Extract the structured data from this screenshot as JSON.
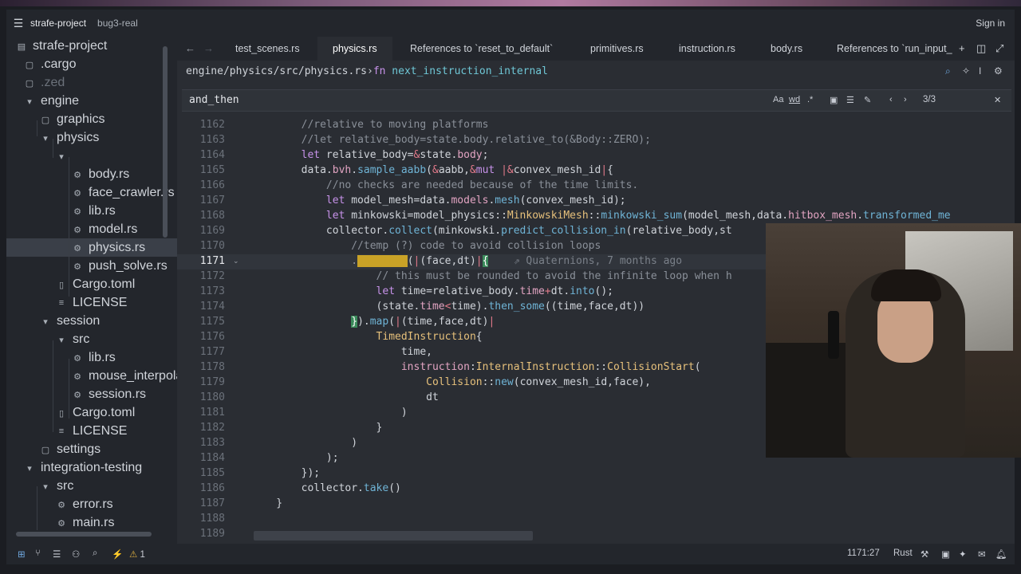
{
  "titlebar": {
    "menu_icon": "hamburger-icon",
    "project": "strafe-project",
    "branch": "bug3-real",
    "signin": "Sign in"
  },
  "sidebar": {
    "rows": [
      {
        "label": "strafe-project",
        "icon": "repo-icon",
        "depth": 0
      },
      {
        "label": ".cargo",
        "icon": "folder-icon",
        "depth": 1
      },
      {
        "label": ".zed",
        "icon": "folder-icon",
        "depth": 1
      },
      {
        "label": "engine",
        "icon": "folder-open-icon",
        "depth": 1
      },
      {
        "label": "graphics",
        "icon": "folder-icon",
        "depth": 2
      },
      {
        "label": "physics",
        "icon": "folder-open-icon",
        "depth": 2
      },
      {
        "label": "",
        "icon": "folder-open-icon",
        "depth": 3
      },
      {
        "label": "body.rs",
        "icon": "rust-file-icon",
        "depth": 4
      },
      {
        "label": "face_crawler.rs",
        "icon": "rust-file-icon",
        "depth": 4
      },
      {
        "label": "lib.rs",
        "icon": "rust-file-icon",
        "depth": 4
      },
      {
        "label": "model.rs",
        "icon": "rust-file-icon",
        "depth": 4
      },
      {
        "label": "physics.rs",
        "icon": "rust-file-icon",
        "depth": 4
      },
      {
        "label": "push_solve.rs",
        "icon": "rust-file-icon",
        "depth": 4
      },
      {
        "label": "Cargo.toml",
        "icon": "toml-file-icon",
        "depth": 3
      },
      {
        "label": "LICENSE",
        "icon": "text-file-icon",
        "depth": 3
      },
      {
        "label": "session",
        "icon": "folder-open-icon",
        "depth": 2
      },
      {
        "label": "src",
        "icon": "folder-open-icon",
        "depth": 3
      },
      {
        "label": "lib.rs",
        "icon": "rust-file-icon",
        "depth": 4
      },
      {
        "label": "mouse_interpolato",
        "icon": "rust-file-icon",
        "depth": 4
      },
      {
        "label": "session.rs",
        "icon": "rust-file-icon",
        "depth": 4
      },
      {
        "label": "Cargo.toml",
        "icon": "toml-file-icon",
        "depth": 3
      },
      {
        "label": "LICENSE",
        "icon": "text-file-icon",
        "depth": 3
      },
      {
        "label": "settings",
        "icon": "folder-icon",
        "depth": 2
      },
      {
        "label": "integration-testing",
        "icon": "folder-open-icon",
        "depth": 1
      },
      {
        "label": "src",
        "icon": "folder-open-icon",
        "depth": 2
      },
      {
        "label": "error.rs",
        "icon": "rust-file-icon",
        "depth": 3
      },
      {
        "label": "main.rs",
        "icon": "rust-file-icon",
        "depth": 3
      }
    ]
  },
  "tabs": {
    "items": [
      {
        "label": "test_scenes.rs"
      },
      {
        "label": "physics.rs",
        "active": true
      },
      {
        "label": "References to `reset_to_default`"
      },
      {
        "label": "primitives.rs"
      },
      {
        "label": "instruction.rs"
      },
      {
        "label": "body.rs"
      },
      {
        "label": "References to `run_input_"
      }
    ]
  },
  "breadcrumb": {
    "path": "engine/physics/src/physics.rs",
    "kw": "fn",
    "fn": "next_instruction_internal"
  },
  "search": {
    "query": "and_then",
    "case_label": "Aa",
    "word_label": "wd",
    "regex_label": ".*",
    "count": "3/3"
  },
  "code": {
    "lines": [
      1162,
      1163,
      1164,
      1165,
      1166,
      1167,
      1168,
      1169,
      1170,
      1171,
      1172,
      1173,
      1174,
      1175,
      1176,
      1177,
      1178,
      1179,
      1180,
      1181,
      1182,
      1183,
      1184,
      1185,
      1186,
      1187,
      1188,
      1189
    ],
    "current_line": 1171,
    "blame": "Quaternions, 7 months ago"
  },
  "statusbar": {
    "warnings": "1",
    "position": "1171:27",
    "language": "Rust"
  }
}
